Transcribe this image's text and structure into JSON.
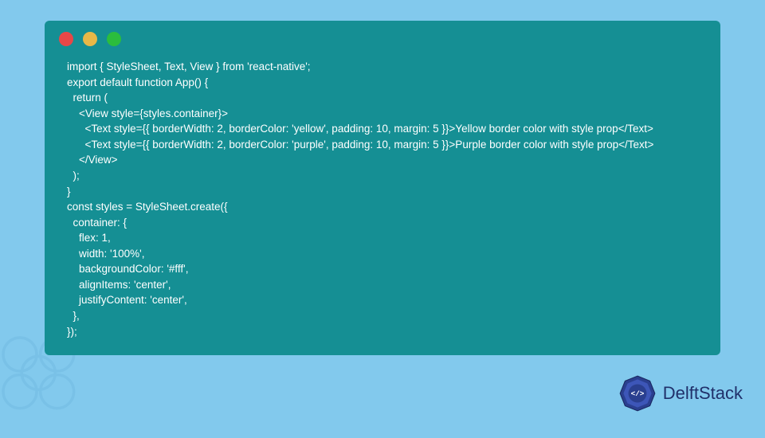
{
  "code": {
    "lines": [
      "import { StyleSheet, Text, View } from 'react-native';",
      "export default function App() {",
      "  return (",
      "    <View style={styles.container}>",
      "      <Text style={{ borderWidth: 2, borderColor: 'yellow', padding: 10, margin: 5 }}>Yellow border color with style prop</Text>",
      "      <Text style={{ borderWidth: 2, borderColor: 'purple', padding: 10, margin: 5 }}>Purple border color with style prop</Text>",
      "    </View>",
      "  );",
      "}",
      "const styles = StyleSheet.create({",
      "  container: {",
      "    flex: 1,",
      "    width: '100%',",
      "    backgroundColor: '#fff',",
      "    alignItems: 'center',",
      "    justifyContent: 'center',",
      "  },",
      "});"
    ]
  },
  "branding": {
    "name": "DelftStack"
  }
}
